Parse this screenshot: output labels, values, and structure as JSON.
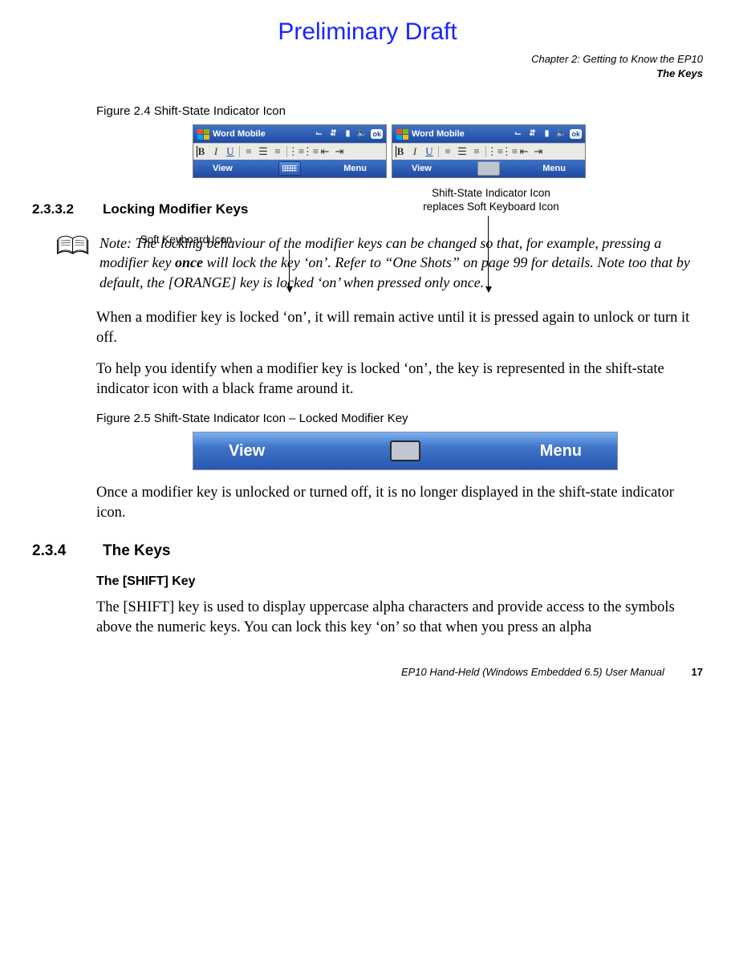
{
  "header": {
    "preliminary": "Preliminary Draft",
    "chapter_line": "Chapter 2: Getting to Know the EP10",
    "section_line": "The Keys"
  },
  "figure24": {
    "caption": "Figure 2.4  Shift-State Indicator Icon",
    "screenshot": {
      "app_title": "Word Mobile",
      "ok_label": "ok",
      "menubar_left": "View",
      "menubar_right": "Menu",
      "toolbar": {
        "bold": "B",
        "italic": "I",
        "underline": "U"
      }
    },
    "annot_left": "Soft Keyboard Icon",
    "annot_right_l1": "Shift-State Indicator Icon",
    "annot_right_l2": "replaces Soft Keyboard Icon"
  },
  "section_2332": {
    "number": "2.3.3.2",
    "title": "Locking Modifier Keys"
  },
  "note": {
    "label": "Note:",
    "body_before_bold": " The locking behaviour of the modifier keys can be changed so that, for example, pressing a modifier key ",
    "bold_word": "once",
    "body_after_bold": " will lock the key ‘on’. Refer to “One Shots” on page 99 for details. Note too that by default, the [ORANGE] key is locked ‘on’ when pressed only once."
  },
  "para1": "When a modifier key is locked ‘on’, it will remain active until it is pressed again to unlock or turn it off.",
  "para2": "To help you identify when a modifier key is locked ‘on’, the key is represented in the shift-state indicator icon with a black frame around it.",
  "figure25": {
    "caption": "Figure 2.5  Shift-State Indicator Icon – Locked Modifier Key",
    "bar_left": "View",
    "bar_right": "Menu"
  },
  "para3": "Once a modifier key is unlocked or turned off, it is no longer displayed in the shift-state indicator icon.",
  "section_234": {
    "number": "2.3.4",
    "title": "The Keys"
  },
  "shift_key": {
    "heading": "The [SHIFT] Key",
    "body": "The [SHIFT] key is used to display uppercase alpha characters and provide access to the symbols above the numeric keys. You can lock this key ‘on’ so that when you press an alpha"
  },
  "footer": {
    "manual": "EP10 Hand-Held (Windows Embedded 6.5) User Manual",
    "page": "17"
  }
}
